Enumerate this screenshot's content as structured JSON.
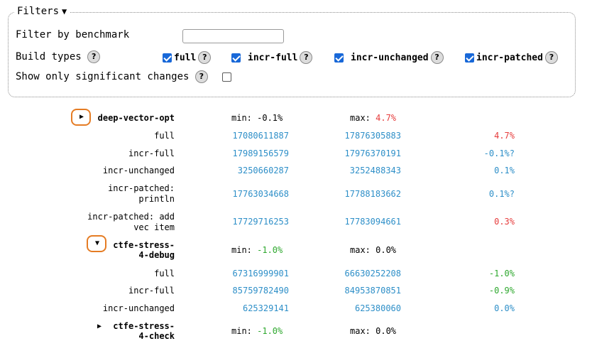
{
  "filters": {
    "title": "Filters",
    "filter_by_benchmark_label": "Filter by benchmark",
    "filter_value": "",
    "build_types_label": "Build types",
    "build_types": [
      {
        "label": "full",
        "checked": true
      },
      {
        "label": "incr-full",
        "checked": true
      },
      {
        "label": "incr-unchanged",
        "checked": true
      },
      {
        "label": "incr-patched",
        "checked": true
      }
    ],
    "significant_label": "Show only significant changes",
    "significant_checked": false,
    "help_glyph": "?"
  },
  "benchmarks": [
    {
      "name": "deep-vector-opt",
      "expanded": false,
      "min": "min: -0.1%",
      "max_prefix": "max: ",
      "max_value": "4.7%",
      "rows": [
        {
          "name": [
            "full"
          ],
          "a": "17080611887",
          "b": "17876305883",
          "diff": "4.7%",
          "tone": "pos"
        },
        {
          "name": [
            "incr-full"
          ],
          "a": "17989156579",
          "b": "17976370191",
          "diff": "-0.1%?",
          "tone": "neu"
        },
        {
          "name": [
            "incr-unchanged"
          ],
          "a": "3250660287",
          "b": "3252488343",
          "diff": "0.1%",
          "tone": "neu"
        },
        {
          "name": [
            "incr-patched:",
            "println"
          ],
          "a": "17763034668",
          "b": "17788183662",
          "diff": "0.1%?",
          "tone": "neu"
        },
        {
          "name": [
            "incr-patched: add",
            "vec item"
          ],
          "a": "17729716253",
          "b": "17783094661",
          "diff": "0.3%",
          "tone": "pos"
        }
      ]
    },
    {
      "name_lines": [
        "ctfe-stress-",
        "4-debug"
      ],
      "expanded": true,
      "min_prefix": "min: ",
      "min_value": "-1.0%",
      "max": "max: 0.0%",
      "rows": [
        {
          "name": [
            "full"
          ],
          "a": "67316999901",
          "b": "66630252208",
          "diff": "-1.0%",
          "tone": "neg"
        },
        {
          "name": [
            "incr-full"
          ],
          "a": "85759782490",
          "b": "84953870851",
          "diff": "-0.9%",
          "tone": "neg"
        },
        {
          "name": [
            "incr-unchanged"
          ],
          "a": "625329141",
          "b": "625380060",
          "diff": "0.0%",
          "tone": "neu"
        }
      ]
    },
    {
      "name_lines": [
        "ctfe-stress-",
        "4-check"
      ],
      "expanded": false,
      "min_prefix": "min: ",
      "min_value": "-1.0%",
      "max": "max: 0.0%"
    }
  ],
  "icons": {
    "collapsed": "triangle-right-icon",
    "expanded": "triangle-down-icon",
    "legend_toggle": "triangle-down-icon"
  },
  "colors": {
    "accent_blue": "#2e8fc8",
    "positive_red": "#e63c3c",
    "negative_green": "#2ea82e",
    "highlight_orange": "#e57c24",
    "checkbox_blue": "#1868d8"
  }
}
